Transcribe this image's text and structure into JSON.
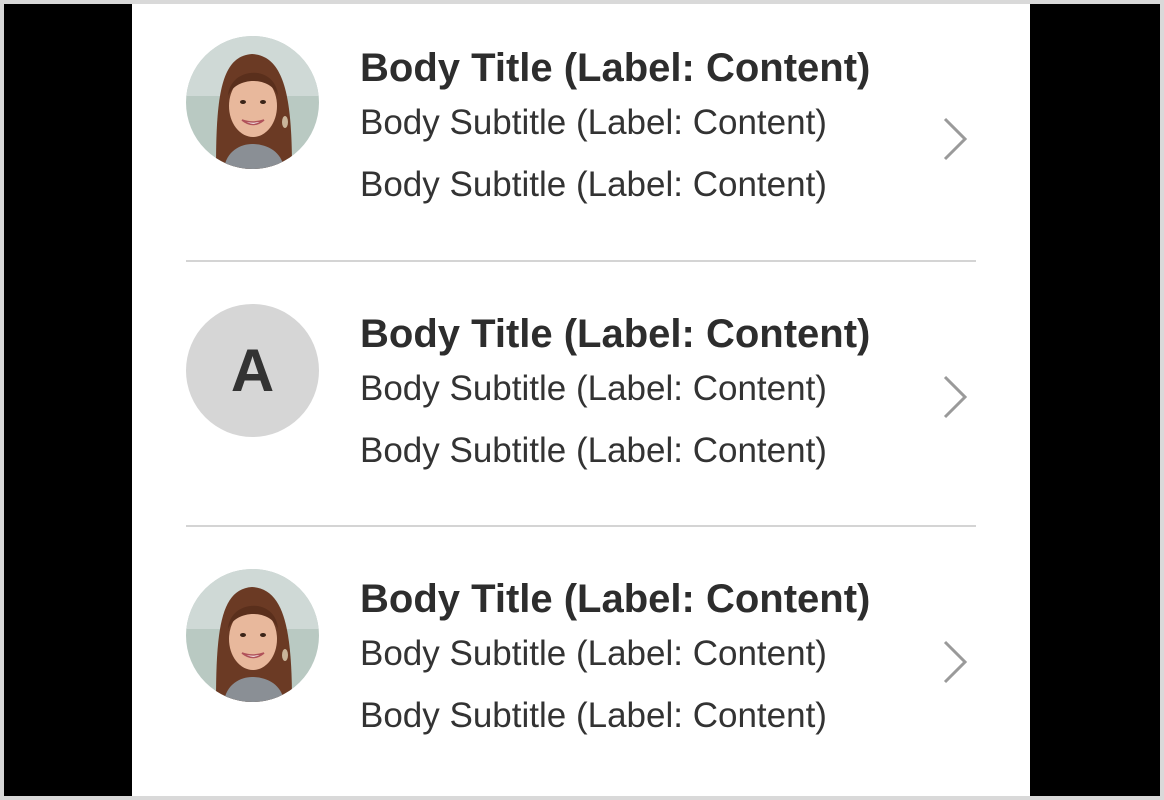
{
  "colors": {
    "background": "#ffffff",
    "outer": "#000000",
    "divider": "#d4d4d4",
    "title_text": "#2d2d2d",
    "subtitle_text": "#333333",
    "avatar_placeholder": "#d6d6d6",
    "chevron": "#9a9a9a"
  },
  "list": {
    "items": [
      {
        "avatar_type": "photo",
        "title": "Body Title (Label: Content)",
        "subtitle_1": "Body Subtitle (Label: Content)",
        "subtitle_2": "Body Subtitle (Label: Content)",
        "icon": "chevron-right-icon"
      },
      {
        "avatar_type": "initial",
        "avatar_initial": "A",
        "title": "Body Title (Label: Content)",
        "subtitle_1": "Body Subtitle (Label: Content)",
        "subtitle_2": "Body Subtitle (Label: Content)",
        "icon": "chevron-right-icon"
      },
      {
        "avatar_type": "photo",
        "title": "Body Title (Label: Content)",
        "subtitle_1": "Body Subtitle (Label: Content)",
        "subtitle_2": "Body Subtitle (Label: Content)",
        "icon": "chevron-right-icon"
      }
    ]
  }
}
